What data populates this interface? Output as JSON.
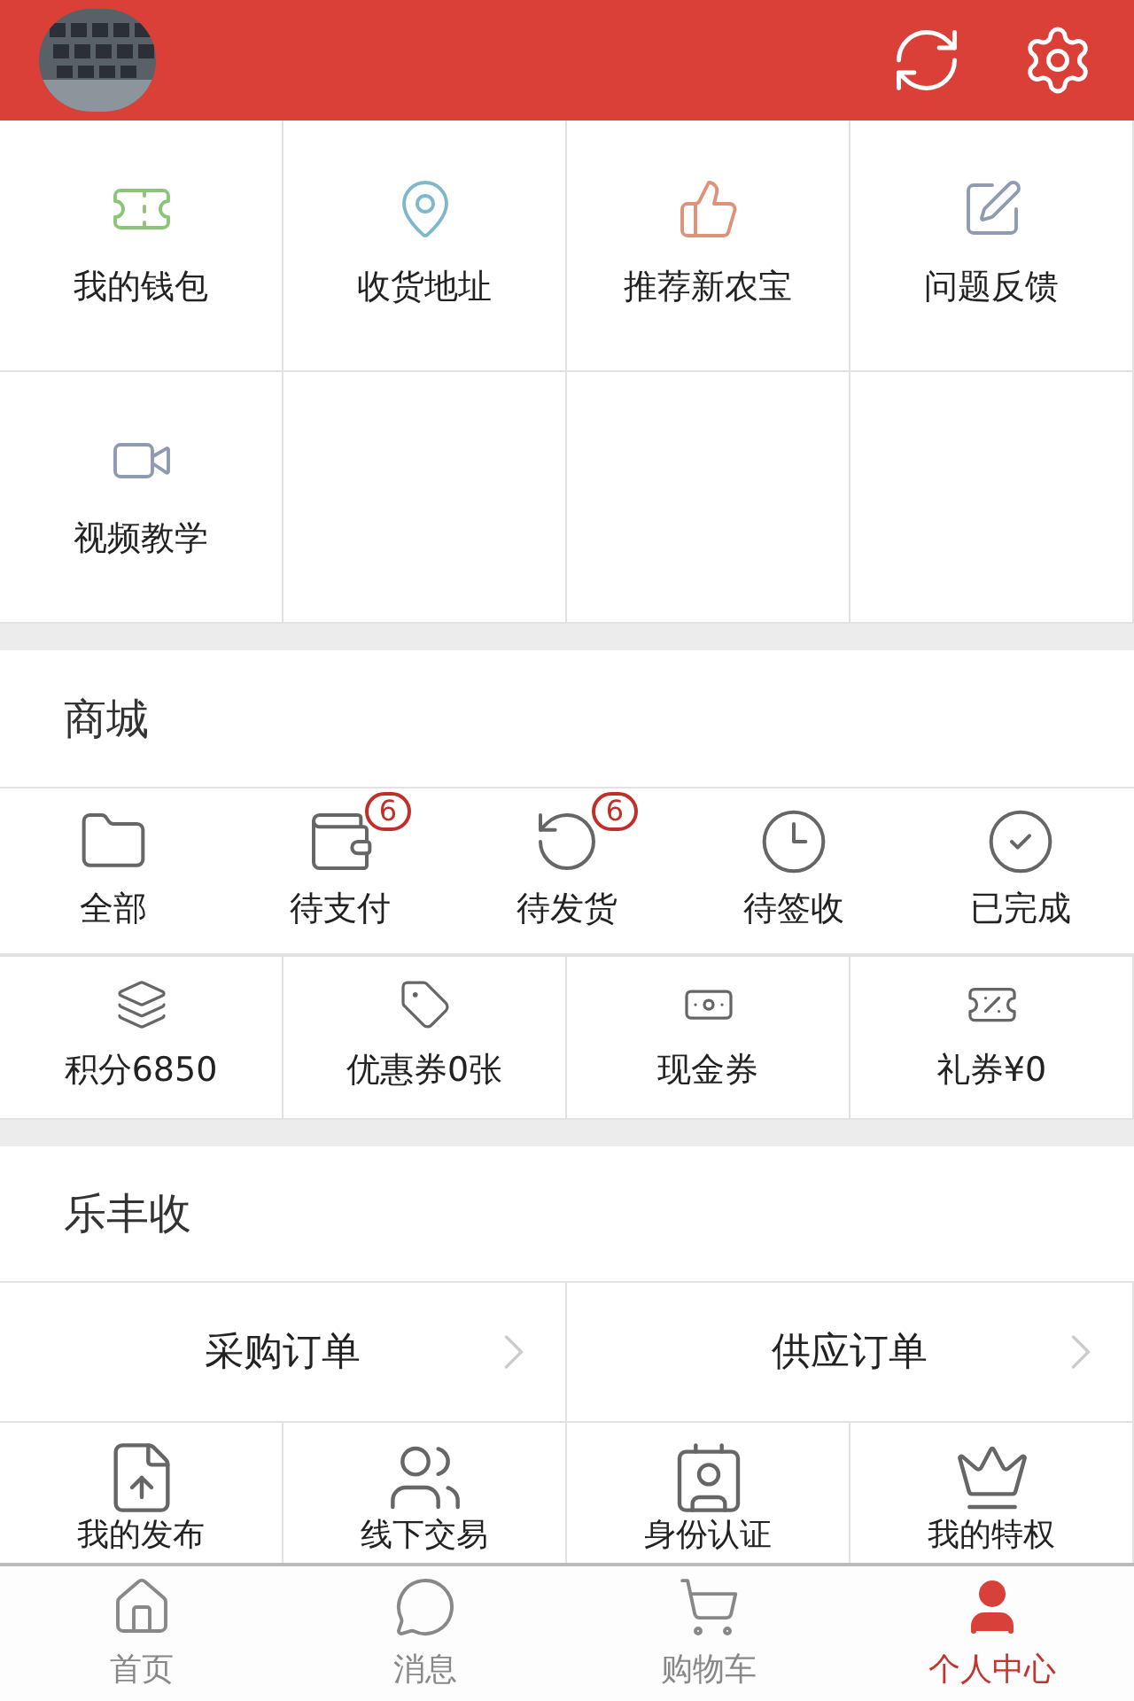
{
  "shortcuts": [
    {
      "label": "我的钱包",
      "color": "#8cc47a"
    },
    {
      "label": "收货地址",
      "color": "#7fb8cc"
    },
    {
      "label": "推荐新农宝",
      "color": "#e0917a"
    },
    {
      "label": "问题反馈",
      "color": "#8f9ab3"
    },
    {
      "label": "视频教学",
      "color": "#8f9ab3"
    }
  ],
  "mall": {
    "title": "商城",
    "order_statuses": [
      {
        "label": "全部"
      },
      {
        "label": "待支付",
        "badge": "6"
      },
      {
        "label": "待发货",
        "badge": "6"
      },
      {
        "label": "待签收"
      },
      {
        "label": "已完成"
      }
    ],
    "assets": [
      {
        "label": "积分6850"
      },
      {
        "label": "优惠券0张"
      },
      {
        "label": "现金券"
      },
      {
        "label": "礼券¥0"
      }
    ]
  },
  "lefengshou": {
    "title": "乐丰收",
    "orders": [
      {
        "label": "采购订单"
      },
      {
        "label": "供应订单"
      }
    ],
    "features": [
      {
        "label": "我的发布"
      },
      {
        "label": "线下交易"
      },
      {
        "label": "身份认证"
      },
      {
        "label": "我的特权"
      }
    ]
  },
  "tab_bar": [
    {
      "label": "首页",
      "selected": false
    },
    {
      "label": "消息",
      "selected": false
    },
    {
      "label": "购物车",
      "selected": false
    },
    {
      "label": "个人中心",
      "selected": true
    }
  ]
}
